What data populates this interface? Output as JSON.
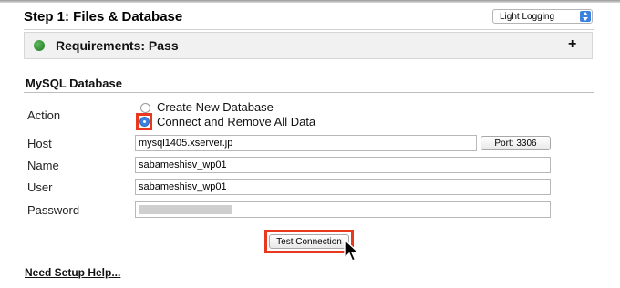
{
  "header": {
    "title": "Step 1: Files & Database",
    "logging_mode": "Light Logging"
  },
  "requirements": {
    "title": "Requirements: Pass",
    "status_color": "#2e9a2e",
    "expand_symbol": "+"
  },
  "mysql": {
    "section_title": "MySQL Database",
    "action_label": "Action",
    "options": [
      {
        "label": "Create New Database",
        "selected": false
      },
      {
        "label": "Connect and Remove All Data",
        "selected": true
      }
    ],
    "host_label": "Host",
    "host_value": "mysql1405.xserver.jp",
    "port_button": "Port: 3306",
    "name_label": "Name",
    "name_value": "sabameshisv_wp01",
    "user_label": "User",
    "user_value": "sabameshisv_wp01",
    "password_label": "Password",
    "test_button": "Test Connection"
  },
  "footer": {
    "help_link": "Need Setup Help..."
  },
  "colors": {
    "highlight": "#e8391e",
    "accent": "#3b82e0"
  }
}
